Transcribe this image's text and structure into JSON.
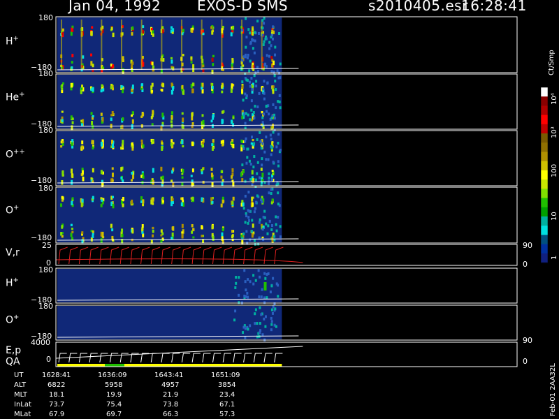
{
  "header": {
    "date": "Jan 04, 1992",
    "mission": "EXOS-D SMS",
    "file": "s2010405.esr",
    "time": "16:28:41"
  },
  "panels": [
    {
      "label": "H",
      "sup": "+",
      "top_tick": "180",
      "bottom_tick": "−180",
      "kind": "spectro"
    },
    {
      "label": "He",
      "sup": "+",
      "top_tick": "180",
      "bottom_tick": "−180",
      "kind": "spectro"
    },
    {
      "label": "O",
      "sup": "++",
      "top_tick": "180",
      "bottom_tick": "−180",
      "kind": "spectro"
    },
    {
      "label": "O",
      "sup": "+",
      "top_tick": "180",
      "bottom_tick": "−180",
      "kind": "spectro"
    },
    {
      "label": "V,r",
      "sup": "",
      "top_tick": "25",
      "bottom_tick": "0",
      "right_top": "90",
      "right_bottom": "0",
      "kind": "line"
    },
    {
      "label": "H",
      "sup": "+",
      "top_tick": "180",
      "bottom_tick": "−180",
      "kind": "spectro2"
    },
    {
      "label": "O",
      "sup": "+",
      "top_tick": "180",
      "bottom_tick": "−180",
      "kind": "spectro2"
    },
    {
      "label": "E,p",
      "label2": "QA",
      "sup": "",
      "top_tick": "4000",
      "bottom_tick": "0",
      "right_top": "90",
      "right_bottom": "0",
      "kind": "line"
    }
  ],
  "colorbar": {
    "unit": "Ct/Smp",
    "ticks": [
      "10⁴",
      "10³",
      "100",
      "10",
      "1"
    ],
    "colors": [
      "#ffffff",
      "#8b0000",
      "#b00000",
      "#ff0000",
      "#c00000",
      "#7a5a00",
      "#907000",
      "#b09000",
      "#d0c000",
      "#ffff00",
      "#c8e600",
      "#80e000",
      "#20c000",
      "#00a000",
      "#00b0a0",
      "#00e0e0",
      "#005080",
      "#0030a0",
      "#102080"
    ]
  },
  "ephemeris": {
    "row_labels": [
      "UT",
      "ALT",
      "MLT",
      "InLat",
      "MLat"
    ],
    "columns": [
      {
        "UT": "1628:41",
        "ALT": "6822",
        "MLT": "18.1",
        "InLat": "73.7",
        "MLat": "67.9"
      },
      {
        "UT": "1636:09",
        "ALT": "5958",
        "MLT": "19.9",
        "InLat": "75.4",
        "MLat": "69.7"
      },
      {
        "UT": "1643:41",
        "ALT": "4957",
        "MLT": "21.9",
        "InLat": "73.8",
        "MLat": "66.3"
      },
      {
        "UT": "1651:09",
        "ALT": "3854",
        "MLT": "23.4",
        "InLat": "67.1",
        "MLat": "57.3"
      }
    ]
  },
  "footer_id": "Feb-01 2AA32L",
  "colors": {
    "background": "#000000",
    "data_bg": "#102878",
    "vr_trace": "#e02020",
    "axis": "#ffffff"
  },
  "chart_data": {
    "type": "heatmap",
    "title": "Jan 04, 1992   EXOS-D SMS",
    "panels": [
      "H+",
      "He+",
      "O++",
      "O+",
      "V,r",
      "H+",
      "O+",
      "E,p"
    ],
    "y_range_pitch": [
      -180,
      180
    ],
    "vr_range": [
      0,
      25
    ],
    "ep_range": [
      0,
      4000
    ],
    "x_ticks_ut": [
      "1628:41",
      "1636:09",
      "1643:41",
      "1651:09"
    ],
    "colorbar_range_ct_smp": [
      1,
      10000
    ],
    "colorbar_scale": "log",
    "n_spin_sweeps": 22,
    "data_end_fraction": 0.49
  }
}
